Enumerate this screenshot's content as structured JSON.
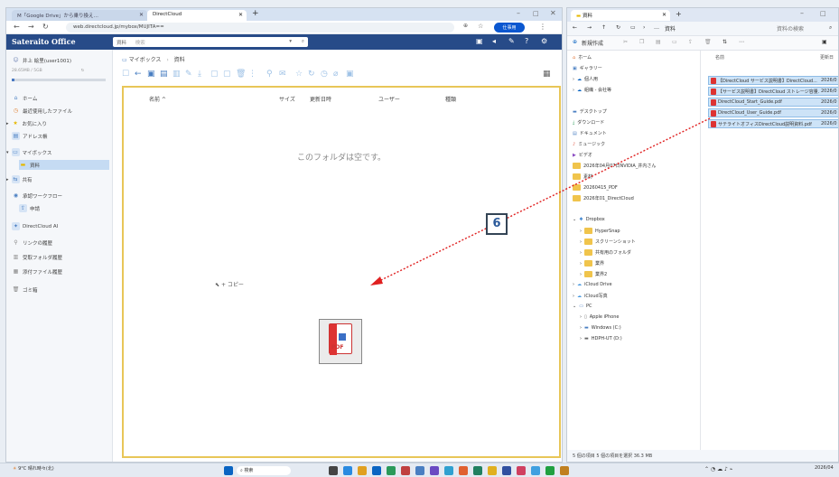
{
  "browser": {
    "tabs": [
      {
        "label": "M「Google Drive」から乗り換え…",
        "active": false
      },
      {
        "label": "DirectCloud",
        "active": true
      }
    ],
    "url": "web.directcloud.jp/mybox/MUJITA==",
    "profile_label": "仕事用"
  },
  "app": {
    "logo": "Sateraito Office",
    "search_scope": "資料",
    "search_placeholder": "検索"
  },
  "sidebar": {
    "user": "井上 絵里(user1001)",
    "quota": "28.65MB / 5GB",
    "items": [
      {
        "label": "ホーム",
        "icon": "home-icon"
      },
      {
        "label": "最近使用したファイル",
        "icon": "clock-icon"
      },
      {
        "label": "お気に入り",
        "icon": "star-icon"
      },
      {
        "label": "アドレス帳",
        "icon": "addressbook-icon"
      },
      {
        "label": "マイボックス",
        "icon": "folder-icon"
      },
      {
        "label": "資料",
        "icon": "folder-icon"
      },
      {
        "label": "共有",
        "icon": "share-icon"
      },
      {
        "label": "承認ワークフロー",
        "icon": "workflow-icon"
      },
      {
        "label": "申請",
        "icon": "request-icon"
      },
      {
        "label": "DirectCloud AI",
        "icon": "ai-icon"
      },
      {
        "label": "リンクの履歴",
        "icon": "link-icon"
      },
      {
        "label": "受取フォルダ履歴",
        "icon": "inbox-icon"
      },
      {
        "label": "添付ファイル履歴",
        "icon": "attachment-icon"
      },
      {
        "label": "ゴミ箱",
        "icon": "trash-icon"
      }
    ]
  },
  "main": {
    "breadcrumb_root": "マイボックス",
    "breadcrumb_current": "資料",
    "columns": [
      "名前 ^",
      "サイズ",
      "更新日時",
      "ユーザー",
      "種類"
    ],
    "empty_message": "このフォルダは空です。",
    "drag_icon_label": "PDF",
    "copy_label": "+ コピー"
  },
  "callout": {
    "number": "6"
  },
  "explorer": {
    "tab_title": "資料",
    "address": "資料",
    "search_placeholder": "資料の検索",
    "new_label": "新規作成",
    "nav": [
      {
        "label": "ホーム",
        "type": "home"
      },
      {
        "label": "ギャラリー",
        "type": "gallery"
      },
      {
        "label": "個人用",
        "type": "cloud"
      },
      {
        "label": "組織 - 会社等",
        "type": "cloud"
      },
      {
        "label": "デスクトップ",
        "type": "desktop"
      },
      {
        "label": "ダウンロード",
        "type": "download"
      },
      {
        "label": "ドキュメント",
        "type": "doc"
      },
      {
        "label": "ミュージック",
        "type": "music"
      },
      {
        "label": "ビデオ",
        "type": "video"
      },
      {
        "label": "2026年04月07日NVIDIA_井内さん",
        "type": "folder"
      },
      {
        "label": "素材",
        "type": "folder"
      },
      {
        "label": "20260415_PDF",
        "type": "folder"
      },
      {
        "label": "2026年01_DirectCloud",
        "type": "folder"
      },
      {
        "label": "Dropbox",
        "type": "dropbox"
      },
      {
        "label": "HyperSnap",
        "type": "folder"
      },
      {
        "label": "スクリーンショット",
        "type": "folder"
      },
      {
        "label": "共有用のフォルダ",
        "type": "folder"
      },
      {
        "label": "業界",
        "type": "folder"
      },
      {
        "label": "業界2",
        "type": "folder"
      },
      {
        "label": "iCloud Drive",
        "type": "cloud"
      },
      {
        "label": "iCloud写真",
        "type": "cloud"
      },
      {
        "label": "PC",
        "type": "pc"
      },
      {
        "label": "Apple iPhone",
        "type": "device"
      },
      {
        "label": "Windows (C:)",
        "type": "drive"
      },
      {
        "label": "HDPH-UT (D:)",
        "type": "drive"
      }
    ],
    "file_headers": [
      "名前",
      "更新日"
    ],
    "files": [
      {
        "name": "【DirectCloud サービス説明書】DirectCloud...",
        "date": "2026/0"
      },
      {
        "name": "【サービス説明書】DirectCloud ストレージ容量...",
        "date": "2026/0"
      },
      {
        "name": "DirectCloud_Start_Guide.pdf",
        "date": "2026/0"
      },
      {
        "name": "DirectCloud_User_Guide.pdf",
        "date": "2026/0"
      },
      {
        "name": "サテライトオフィスDirectCloud説明資料.pdf",
        "date": "2026/0"
      }
    ],
    "status": "5 個の項目   5 個の項目を選択 36.3 MB"
  },
  "taskbar": {
    "weather_temp": "9°C",
    "weather_desc": "晴れ時々(北)",
    "search_label": "検索",
    "clock": "2026/04"
  }
}
